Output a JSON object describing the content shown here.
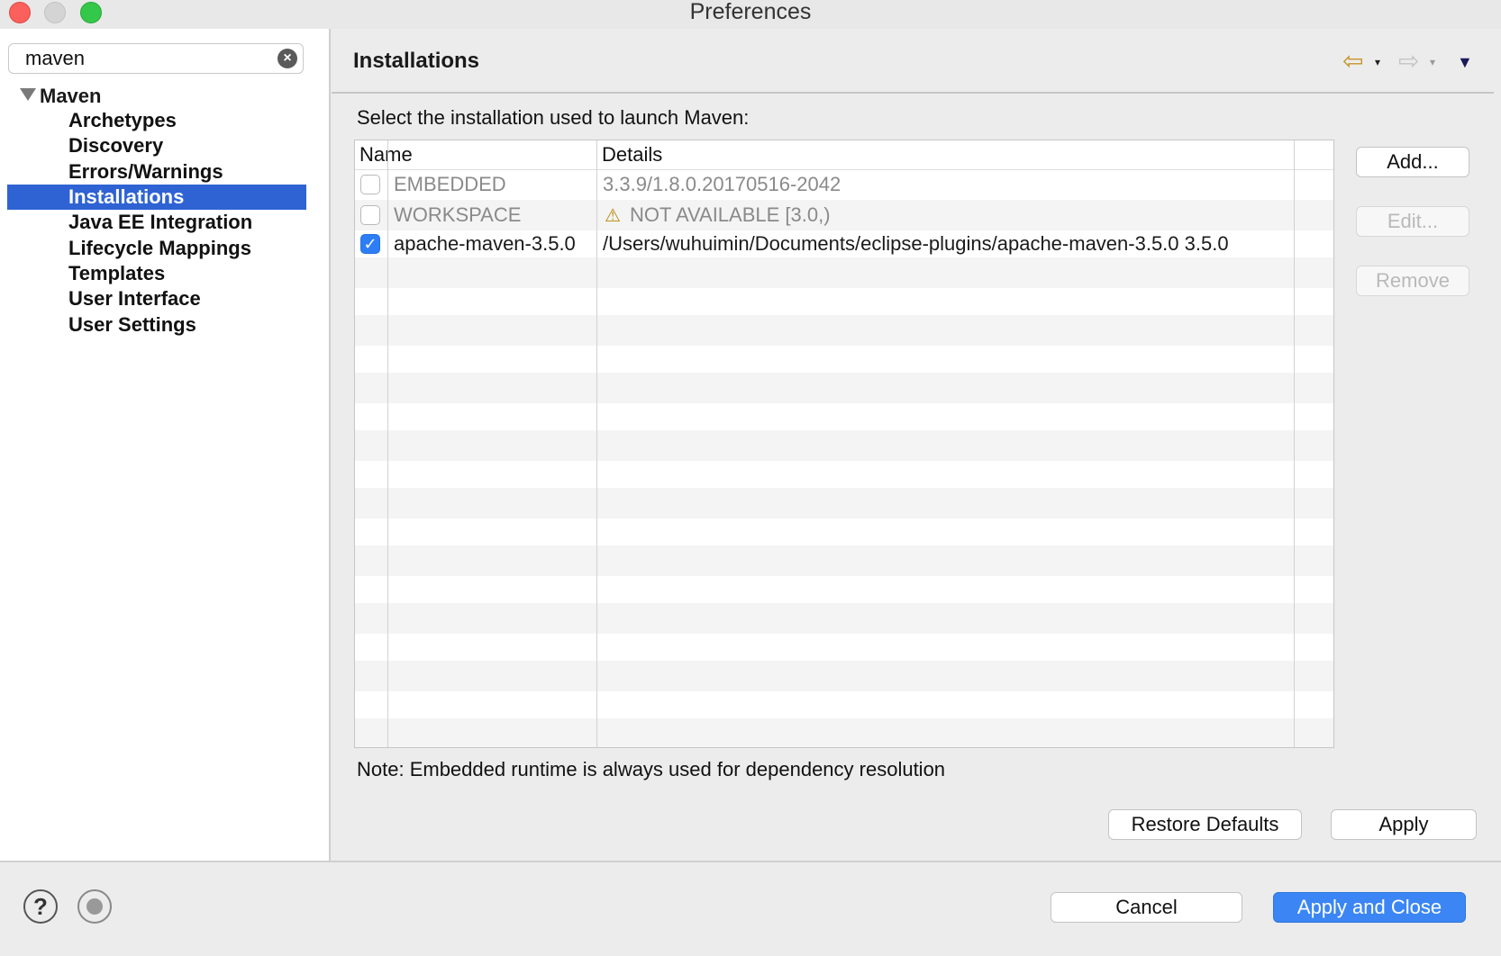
{
  "window": {
    "title": "Preferences"
  },
  "search": {
    "value": "maven"
  },
  "tree": {
    "root": "Maven",
    "items": [
      {
        "label": "Archetypes"
      },
      {
        "label": "Discovery"
      },
      {
        "label": "Errors/Warnings"
      },
      {
        "label": "Installations"
      },
      {
        "label": "Java EE Integration"
      },
      {
        "label": "Lifecycle Mappings"
      },
      {
        "label": "Templates"
      },
      {
        "label": "User Interface"
      },
      {
        "label": "User Settings"
      }
    ],
    "selected": "Installations"
  },
  "page": {
    "title": "Installations",
    "instruction": "Select the installation used to launch Maven:",
    "note": "Note: Embedded runtime is always used for dependency resolution"
  },
  "table": {
    "headers": {
      "name": "Name",
      "details": "Details"
    },
    "rows": [
      {
        "checked": false,
        "name": "EMBEDDED",
        "details": "3.3.9/1.8.0.20170516-2042",
        "dim": true
      },
      {
        "checked": false,
        "name": "WORKSPACE",
        "details": "NOT AVAILABLE [3.0,)",
        "dim": true,
        "warning": true
      },
      {
        "checked": true,
        "name": "apache-maven-3.5.0",
        "details": "/Users/wuhuimin/Documents/eclipse-plugins/apache-maven-3.5.0 3.5.0",
        "dim": false
      }
    ]
  },
  "buttons": {
    "add": "Add...",
    "edit": "Edit...",
    "remove": "Remove",
    "restore_defaults": "Restore Defaults",
    "apply": "Apply",
    "cancel": "Cancel",
    "apply_and_close": "Apply and Close"
  },
  "icons": {
    "warning": "⚠",
    "check": "✓",
    "help": "?",
    "clear": "×",
    "back": "⇦",
    "forward": "⇨",
    "drop": "▾",
    "menu": "▼"
  },
  "colors": {
    "selection": "#2f63d4",
    "primary_button": "#3b86f4",
    "warning": "#b88700"
  }
}
